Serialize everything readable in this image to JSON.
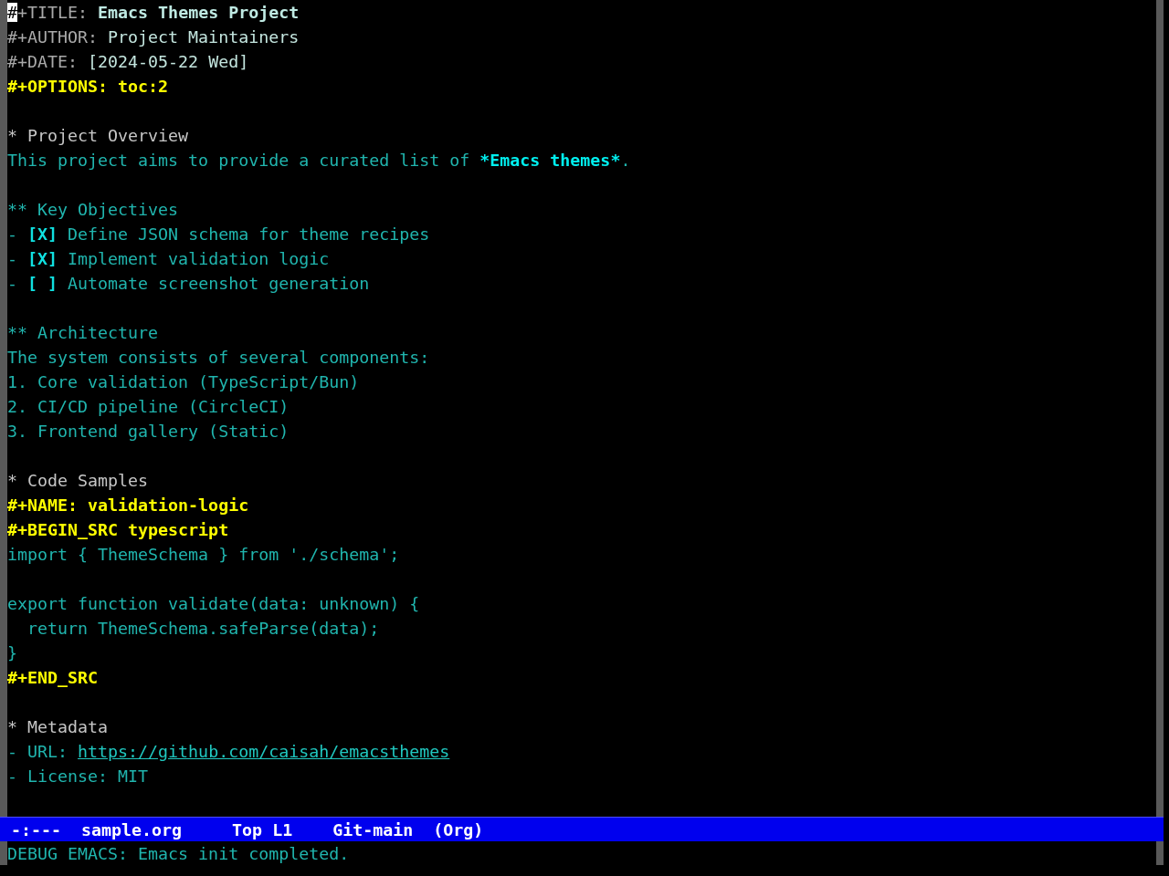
{
  "buffer": {
    "lines": [
      {
        "kind": "keyword",
        "key": "#+TITLE:",
        "value": "Emacs Themes Project",
        "bold": true,
        "cursor": true
      },
      {
        "kind": "keyword",
        "key": "#+AUTHOR:",
        "value": "Project Maintainers",
        "bold": false,
        "cursor": false
      },
      {
        "kind": "keyword",
        "key": "#+DATE:",
        "value": "[2024-05-22 Wed]",
        "bold": false,
        "cursor": false
      },
      {
        "kind": "option",
        "text": "#+OPTIONS: toc:2"
      },
      {
        "kind": "blank"
      },
      {
        "kind": "heading",
        "text": "* Project Overview"
      },
      {
        "kind": "paragraph",
        "segments": [
          {
            "kind": "plain",
            "text": "This project aims to provide a curated list of "
          },
          {
            "kind": "emphasis",
            "text": "*Emacs themes*"
          },
          {
            "kind": "plain",
            "text": "."
          }
        ]
      },
      {
        "kind": "blank"
      },
      {
        "kind": "subheading",
        "text": "** Key Objectives"
      },
      {
        "kind": "checkbox_item",
        "bullet": "-",
        "box": "[X]",
        "text": "Define JSON schema for theme recipes"
      },
      {
        "kind": "checkbox_item",
        "bullet": "-",
        "box": "[X]",
        "text": "Implement validation logic"
      },
      {
        "kind": "checkbox_item",
        "bullet": "-",
        "box": "[ ]",
        "text": "Automate screenshot generation"
      },
      {
        "kind": "blank"
      },
      {
        "kind": "subheading",
        "text": "** Architecture"
      },
      {
        "kind": "paragraph",
        "segments": [
          {
            "kind": "plain",
            "text": "The system consists of several components:"
          }
        ]
      },
      {
        "kind": "ordered_item",
        "text": "1. Core validation (TypeScript/Bun)"
      },
      {
        "kind": "ordered_item",
        "text": "2. CI/CD pipeline (CircleCI)"
      },
      {
        "kind": "ordered_item",
        "text": "3. Frontend gallery (Static)"
      },
      {
        "kind": "blank"
      },
      {
        "kind": "heading",
        "text": "* Code Samples"
      },
      {
        "kind": "block_keyword",
        "text": "#+NAME: validation-logic"
      },
      {
        "kind": "block_keyword",
        "text": "#+BEGIN_SRC typescript"
      },
      {
        "kind": "code",
        "text": "import { ThemeSchema } from './schema';"
      },
      {
        "kind": "blank"
      },
      {
        "kind": "code",
        "text": "export function validate(data: unknown) {"
      },
      {
        "kind": "code",
        "text": "  return ThemeSchema.safeParse(data);"
      },
      {
        "kind": "code",
        "text": "}"
      },
      {
        "kind": "block_keyword",
        "text": "#+END_SRC"
      },
      {
        "kind": "blank"
      },
      {
        "kind": "heading",
        "text": "* Metadata"
      },
      {
        "kind": "link_item",
        "label": "- URL:",
        "link": "https://github.com/caisah/emacsthemes"
      },
      {
        "kind": "list_item",
        "text": "- License: MIT"
      }
    ]
  },
  "mode_line": {
    "segments": [
      {
        "kind": "status",
        "text": "-:---"
      },
      {
        "kind": "buffer_name",
        "text": "sample.org"
      },
      {
        "kind": "position",
        "text": "Top L1"
      },
      {
        "kind": "vc",
        "text": "Git-main"
      },
      {
        "kind": "major_mode",
        "text": "(Org)"
      }
    ]
  },
  "echo_area": {
    "message": "DEBUG EMACS: Emacs init completed."
  }
}
